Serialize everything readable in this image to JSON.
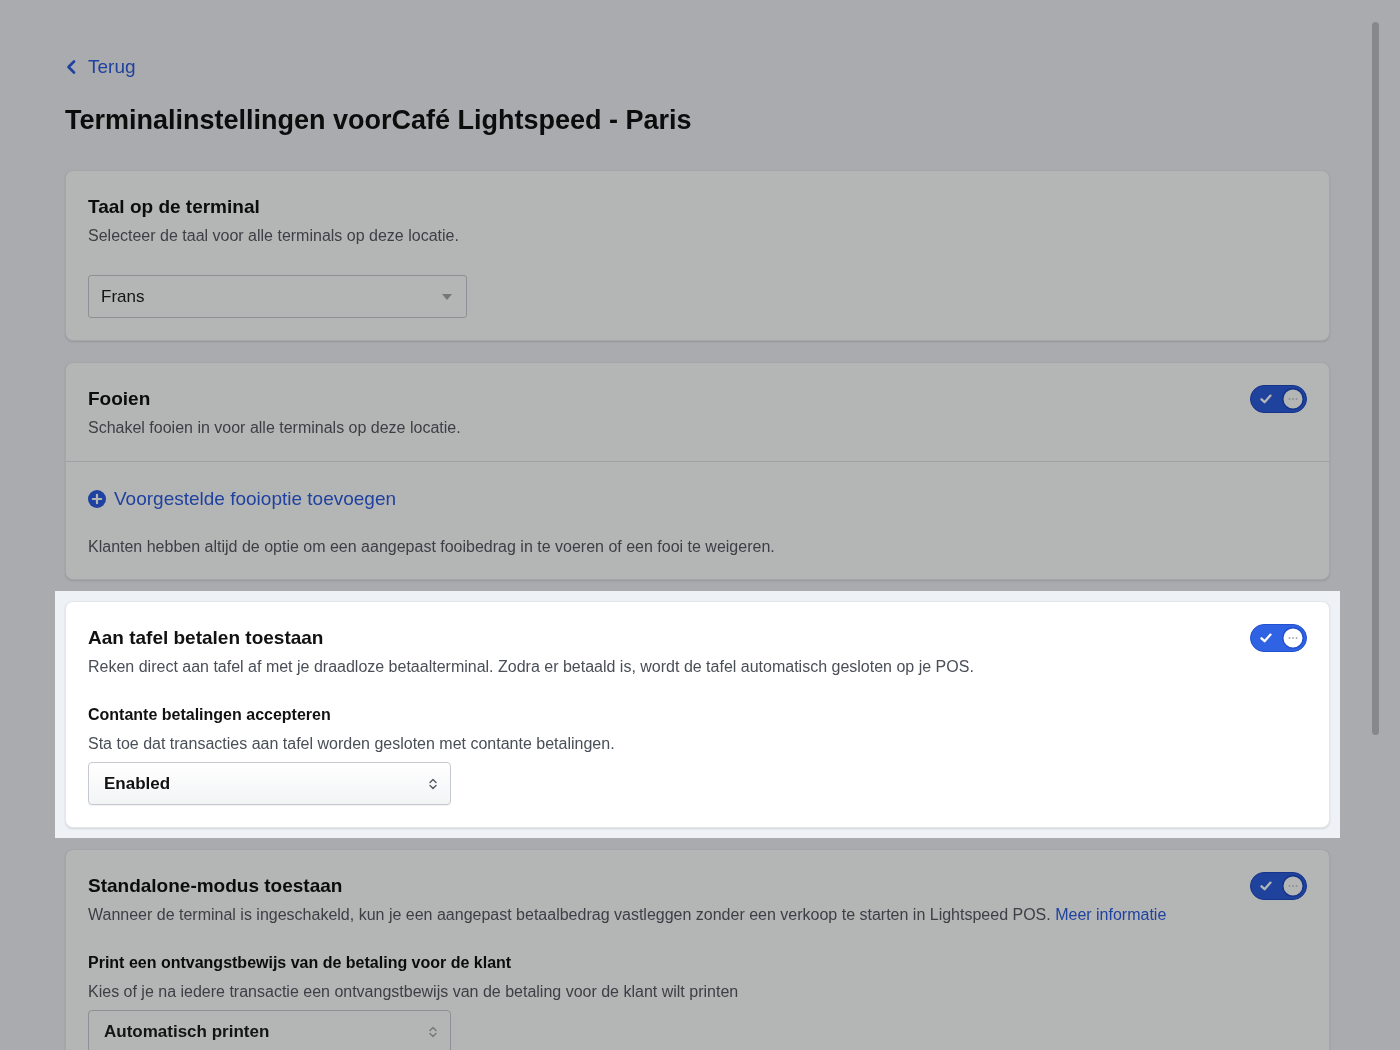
{
  "back_link": {
    "label": "Terug"
  },
  "title": "Terminalinstellingen voorCafé Lightspeed - Paris",
  "sections": [
    {
      "title": "Taal op de terminal",
      "description": "Selecteer de taal voor alle terminals op deze locatie.",
      "highlighted": false,
      "select": {
        "kind": "dropdown",
        "value": "Frans"
      }
    },
    {
      "title": "Fooien",
      "description": "Schakel fooien in voor alle terminals op deze locatie.",
      "highlighted": false,
      "toggle": {
        "on": true
      },
      "add_link": {
        "label": "Voorgestelde fooioptie toevoegen"
      },
      "note": "Klanten hebben altijd de optie om een aangepast fooibedrag in te voeren of een fooi te weigeren."
    },
    {
      "title": "Aan tafel betalen toestaan",
      "description": "Reken direct aan tafel af met je draadloze betaalterminal. Zodra er betaald is, wordt de tafel automatisch gesloten op je POS.",
      "highlighted": true,
      "toggle": {
        "on": true
      },
      "settings": [
        {
          "label": "Contante betalingen accepteren",
          "description": "Sta toe dat transacties aan tafel worden gesloten met contante betalingen.",
          "select": {
            "kind": "stepper",
            "value": "Enabled"
          }
        }
      ]
    },
    {
      "title": "Standalone-modus toestaan",
      "description": "Wanneer de terminal is ingeschakeld, kun je een aangepast betaalbedrag vastleggen zonder een verkoop te starten in Lightspeed POS.",
      "link": "Meer informatie",
      "highlighted": false,
      "toggle": {
        "on": true
      },
      "settings": [
        {
          "label": "Print een ontvangstbewijs van de betaling voor de klant",
          "description": "Kies of je na iedere transactie een ontvangstbewijs van de betaling voor de klant wilt printen",
          "select": {
            "kind": "stepper",
            "value": "Automatisch printen"
          }
        }
      ]
    }
  ]
}
